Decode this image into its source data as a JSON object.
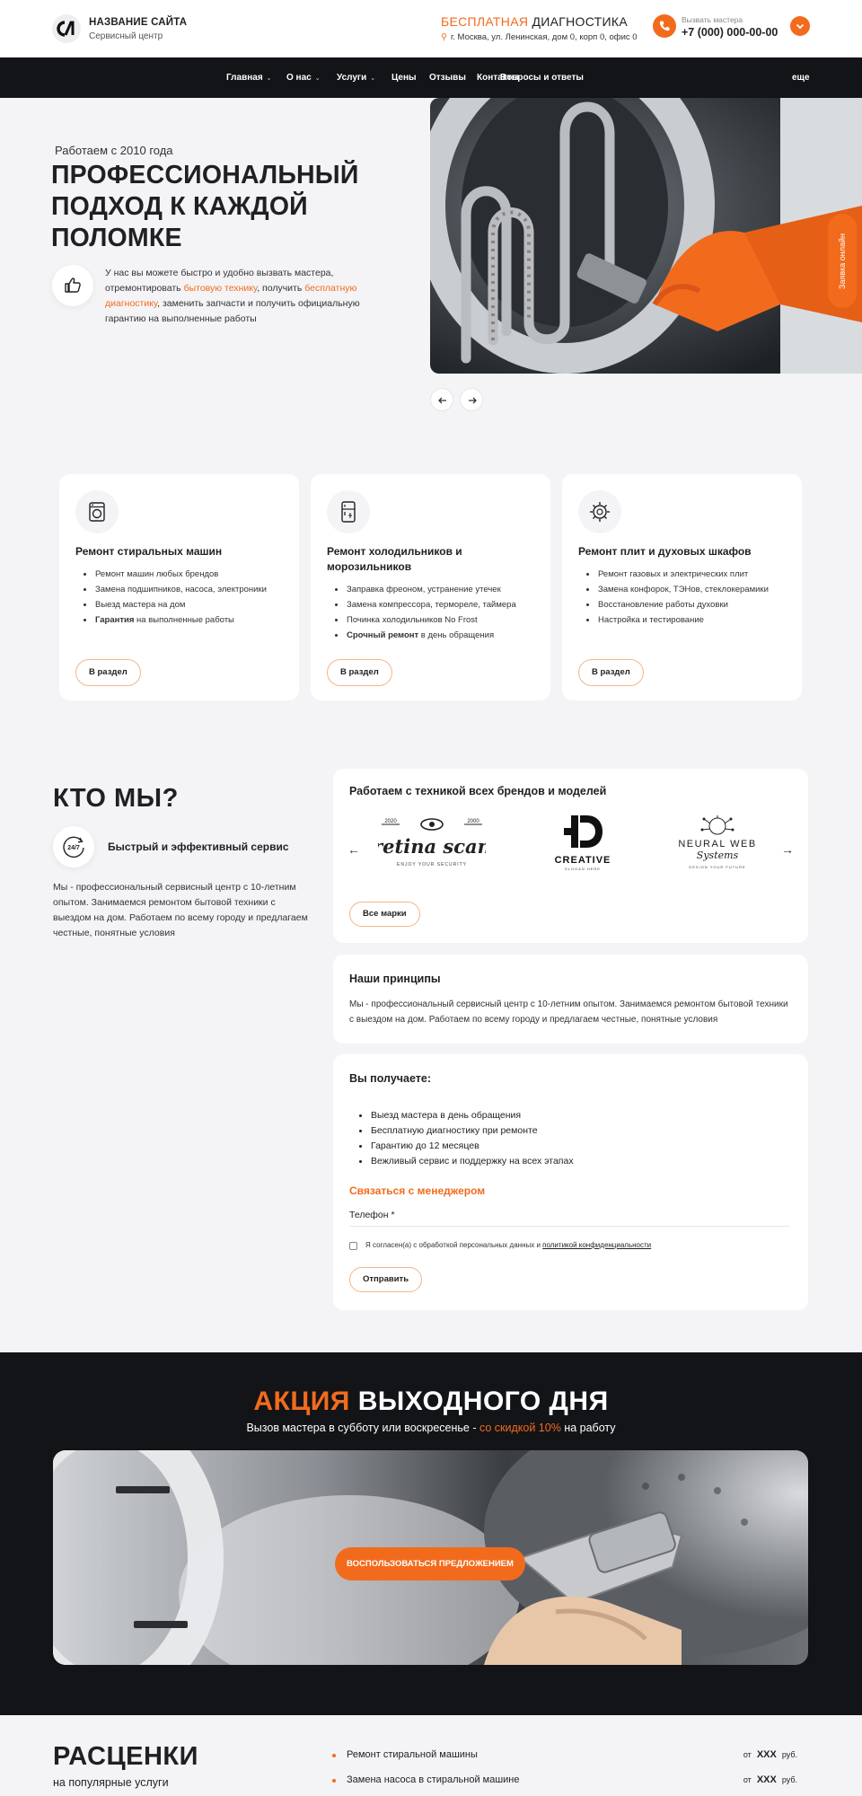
{
  "header": {
    "site_name": "НАЗВАНИЕ САЙТА",
    "site_sub": "Сервисный центр",
    "diag_accent": "БЕСПЛАТНАЯ",
    "diag_rest": " ДИАГНОСТИКА",
    "address": "г. Москва, ул. Ленинская, дом 0, корп 0, офис 0",
    "call_label": "Вызвать мастера",
    "phone": "+7 (000) 000-00-00"
  },
  "nav": {
    "items": [
      {
        "label": "Главная"
      },
      {
        "label": "О нас"
      },
      {
        "label": "Услуги"
      },
      {
        "label": "Цены"
      },
      {
        "label": "Отзывы"
      },
      {
        "label": "Контакты"
      },
      {
        "label": "Вопросы и ответы"
      }
    ],
    "more": "еще"
  },
  "hero": {
    "since": "Работаем с 2010 года",
    "title": "ПРОФЕССИОНАЛЬНЫЙ ПОДХОД К КАЖДОЙ ПОЛОМКЕ",
    "desc_1": "У нас вы можете быстро и удобно вызвать мастера, отремонтировать ",
    "desc_link_1": "бытовую технику",
    "desc_2": ", получить ",
    "desc_link_2": "бесплатную диагностику",
    "desc_3": ", заменить запчасти и получить официальную гарантию на выполненные работы",
    "side_tab": "Заявка онлайн"
  },
  "services": [
    {
      "title": "Ремонт стиральных машин",
      "items": [
        "Ремонт машин любых брендов",
        "Замена подшипников, насоса, электроники",
        "Выезд мастера на дом"
      ],
      "bold_item_bold": "Гарантия",
      "bold_item_rest": " на выполненные работы",
      "button": "В раздел",
      "icon": "washing-machine-icon"
    },
    {
      "title": "Ремонт холодильников и морозильников",
      "items": [
        "Заправка фреоном, устранение утечек",
        "Замена компрессора, термореле, таймера",
        "Починка холодильников No Frost"
      ],
      "bold_item_bold": "Срочный ремонт",
      "bold_item_rest": " в день обращения",
      "button": "В раздел",
      "icon": "fridge-icon"
    },
    {
      "title": "Ремонт плит и духовых шкафов",
      "items": [
        "Ремонт газовых и электрических плит",
        "Замена конфорок, ТЭНов, стеклокерамики",
        "Восстановление работы духовки",
        "Настройка и тестирование"
      ],
      "button": "В раздел",
      "icon": "stove-icon"
    }
  ],
  "about": {
    "title": "КТО МЫ?",
    "subtitle": "Быстрый и эффективный сервис",
    "desc": "Мы - профессиональный сервисный центр с 10-летним опытом. Занимаемся ремонтом бытовой техники с выездом на дом. Работаем по всему городу и предлагаем честные, понятные условия",
    "badge_text": "24/7"
  },
  "brands": {
    "title": "Работаем с техникой всех брендов и моделей",
    "logos": [
      {
        "name": "retina scan",
        "tagline": "ENJOY YOUR SECURITY",
        "left_no": "2020",
        "right_no": "2000"
      },
      {
        "name": "CREATIVE",
        "tagline": "SLOGAN HERE"
      },
      {
        "name": "NEURAL WEB",
        "script": "Systems",
        "tagline": "DESIGN YOUR FUTURE"
      }
    ],
    "button": "Все марки"
  },
  "principles": {
    "title": "Наши принципы",
    "text": "Мы - профессиональный сервисный центр с 10-летним опытом. Занимаемся ремонтом бытовой техники с выездом на дом. Работаем по всему городу и предлагаем честные, понятные условия"
  },
  "benefits": {
    "title": "Вы получаете:",
    "items": [
      "Выезд мастера в день обращения",
      "Бесплатную диагностику при ремонте",
      "Гарантию до 12 месяцев",
      "Вежливый сервис и поддержку на всех этапах"
    ],
    "contact_title": "Связаться с менеджером",
    "phone_label": "Телефон *",
    "consent_text": "Я согласен(а) с обработкой персональных данных и ",
    "consent_link": "политикой конфиденциальности",
    "submit": "Отправить"
  },
  "promo": {
    "title_accent": "АКЦИЯ",
    "title_rest": " ВЫХОДНОГО ДНЯ",
    "sub_1": "Вызов мастера в субботу или воскресенье - ",
    "sub_accent": "со скидкой 10%",
    "sub_2": " на работу",
    "button": "ВОСПОЛЬЗОВАТЬСЯ ПРЕДЛОЖЕНИЕМ"
  },
  "prices": {
    "title": "РАСЦЕНКИ",
    "subtitle": "на популярные услуги",
    "rows": [
      {
        "name": "Ремонт стиральной машины",
        "from": "от",
        "value": "XXX",
        "unit": "руб."
      },
      {
        "name": "Замена насоса в стиральной машине",
        "from": "от",
        "value": "XXX",
        "unit": "руб."
      }
    ]
  },
  "colors": {
    "accent": "#f26b1d",
    "dark": "#121417",
    "bg": "#f4f4f6"
  }
}
